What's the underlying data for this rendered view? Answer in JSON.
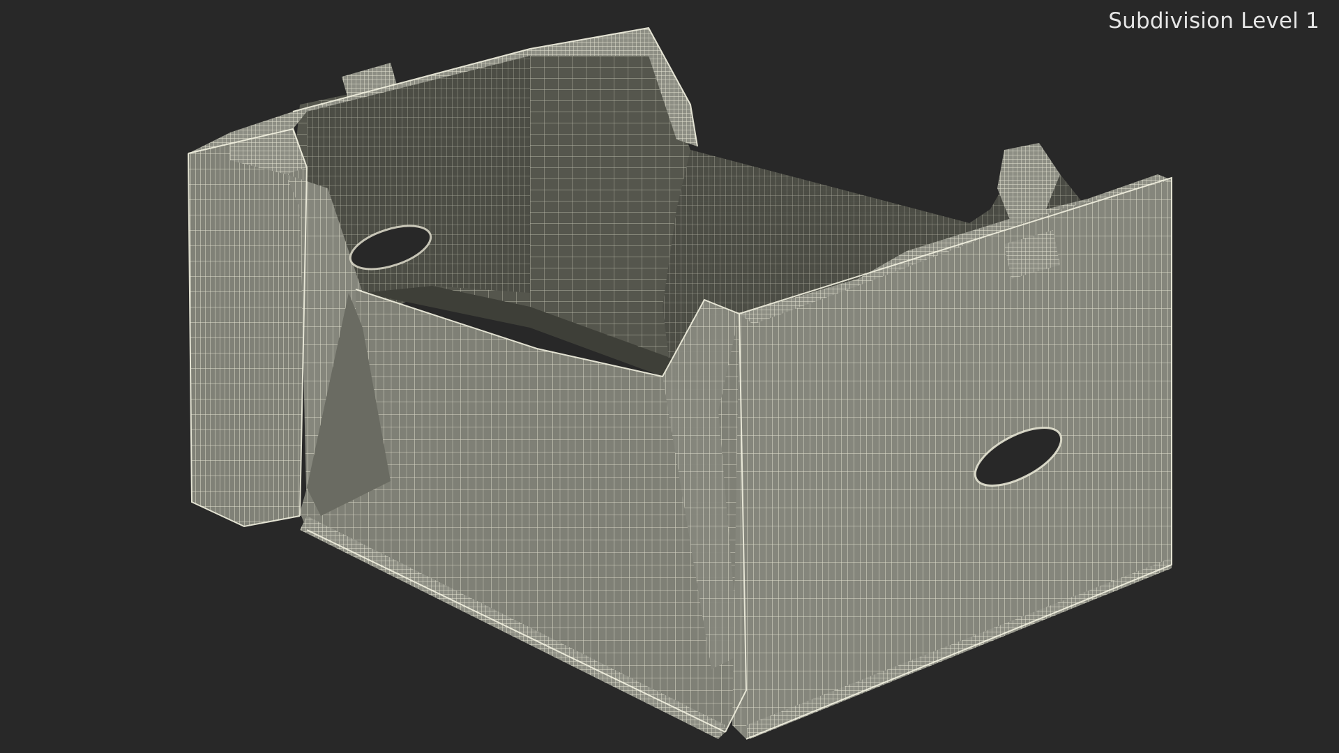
{
  "viewport": {
    "label": "Subdivision Level 1",
    "background_color": "#282828",
    "label_color": "#e6e6e6"
  },
  "model": {
    "render_style": "wireframe-over-shaded",
    "surface_color": "#7e7e74",
    "inner_surface_color": "#4f5048",
    "wire_color": "#e8e6d4",
    "icons": [
      "crate-wireframe-model"
    ]
  }
}
